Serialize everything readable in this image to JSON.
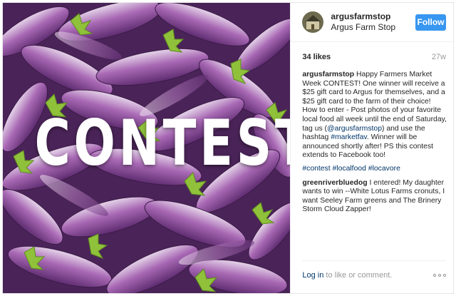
{
  "photo": {
    "overlay_text": "CONTEST!",
    "colors": {
      "eggplant": "#8e4f9c",
      "eggplant_light": "#d7c0de",
      "leaf": "#8fc13b",
      "text": "#ffffff"
    }
  },
  "header": {
    "username": "argusfarmstop",
    "full_name": "Argus Farm Stop",
    "follow_label": "Follow"
  },
  "stats": {
    "likes": "34 likes",
    "age": "27w"
  },
  "caption": {
    "author": "argusfarmstop",
    "text_1": "Happy Farmers Market Week CONTEST! One winner will receive a $25 gift card to Argus for themselves, and a $25 gift card to the farm of their choice! How to enter - Post photos of your favorite local food all week until the end of Saturday, tag us (",
    "mention": "@argusfarmstop",
    "text_2": ") and use the hashtag ",
    "hashtag": "#marketfav",
    "text_3": ". Winner will be announced shortly after! PS this contest extends to Facebook too!"
  },
  "hashtags": [
    "#contest",
    "#localfood",
    "#locavore"
  ],
  "comment": {
    "author": "greenriverbluedog",
    "text": "I entered! My daughter wants to win --White Lotus Farms cronuts, I want Seeley Farm greens and The Brinery Storm Cloud Zapper!"
  },
  "footer": {
    "login_link": "Log in",
    "login_rest": " to like or comment.",
    "more_icon": "ellipsis-icon"
  },
  "accent": "#3897f0"
}
